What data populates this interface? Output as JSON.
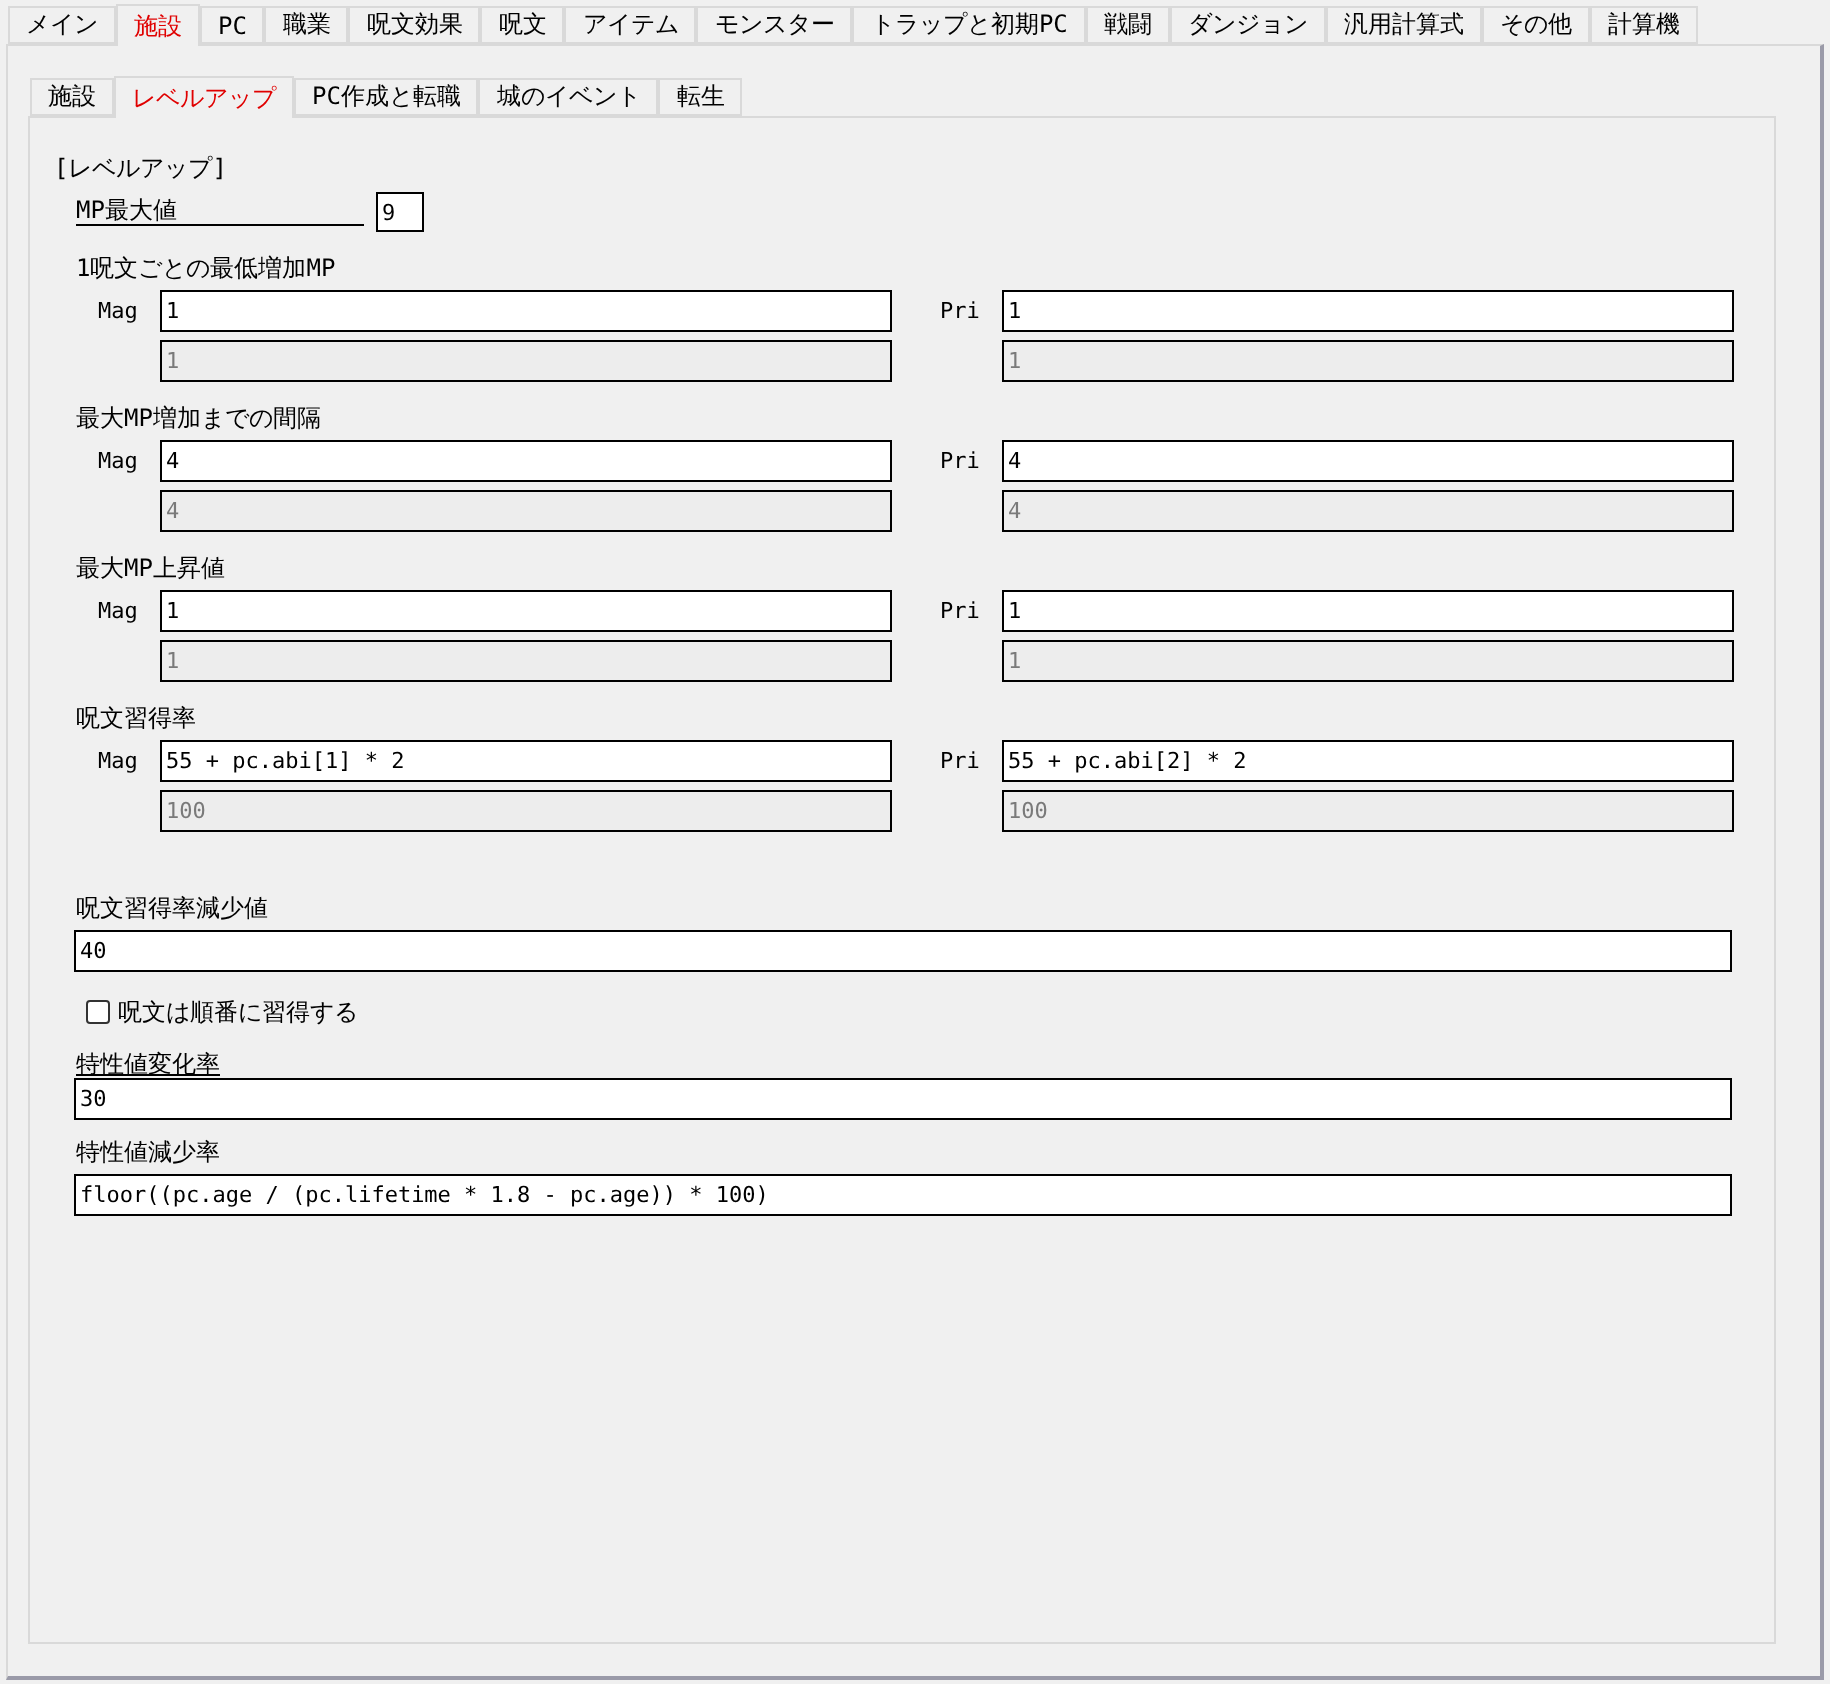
{
  "top_tabs": [
    {
      "label": "メイン",
      "selected": false
    },
    {
      "label": "施設",
      "selected": true
    },
    {
      "label": "PC",
      "selected": false
    },
    {
      "label": "職業",
      "selected": false
    },
    {
      "label": "呪文効果",
      "selected": false
    },
    {
      "label": "呪文",
      "selected": false
    },
    {
      "label": "アイテム",
      "selected": false
    },
    {
      "label": "モンスター",
      "selected": false
    },
    {
      "label": "トラップと初期PC",
      "selected": false
    },
    {
      "label": "戦闘",
      "selected": false
    },
    {
      "label": "ダンジョン",
      "selected": false
    },
    {
      "label": "汎用計算式",
      "selected": false
    },
    {
      "label": "その他",
      "selected": false
    },
    {
      "label": "計算機",
      "selected": false
    }
  ],
  "sub_tabs": [
    {
      "label": "施設",
      "selected": false
    },
    {
      "label": "レベルアップ",
      "selected": true
    },
    {
      "label": "PC作成と転職",
      "selected": false
    },
    {
      "label": "城のイベント",
      "selected": false
    },
    {
      "label": "転生",
      "selected": false
    }
  ],
  "section_title": "[レベルアップ]",
  "mp_max": {
    "label": "MP最大値",
    "value": "9"
  },
  "class_fields": [
    {
      "title": "1呪文ごとの最低増加MP",
      "columns": [
        {
          "label": "Mag",
          "value": "1",
          "result": "1"
        },
        {
          "label": "Pri",
          "value": "1",
          "result": "1"
        }
      ]
    },
    {
      "title": "最大MP増加までの間隔",
      "columns": [
        {
          "label": "Mag",
          "value": "4",
          "result": "4"
        },
        {
          "label": "Pri",
          "value": "4",
          "result": "4"
        }
      ]
    },
    {
      "title": "最大MP上昇値",
      "columns": [
        {
          "label": "Mag",
          "value": "1",
          "result": "1"
        },
        {
          "label": "Pri",
          "value": "1",
          "result": "1"
        }
      ]
    },
    {
      "title": "呪文習得率",
      "columns": [
        {
          "label": "Mag",
          "value": "55 + pc.abi[1] * 2",
          "result": "100"
        },
        {
          "label": "Pri",
          "value": "55 + pc.abi[2] * 2",
          "result": "100"
        }
      ]
    }
  ],
  "decrease": {
    "label": "呪文習得率減少値",
    "value": "40"
  },
  "checkbox": {
    "label": "呪文は順番に習得する",
    "checked": false
  },
  "stat_fields": [
    {
      "label": "特性値変化率",
      "value": "30",
      "underlined": true
    },
    {
      "label": "特性値減少率",
      "value": "floor((pc.age / (pc.lifetime * 1.8 - pc.age)) * 100)",
      "underlined": false
    }
  ]
}
